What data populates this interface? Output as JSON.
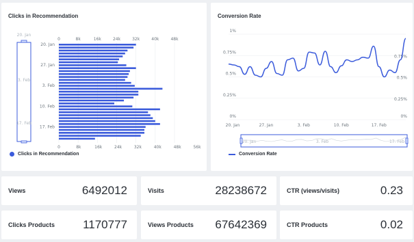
{
  "colors": {
    "series": "#3b5bdb",
    "grid": "#e9ecef",
    "axis_text": "#6c757d",
    "navigator_mask": "#3b5bdb"
  },
  "clicks_card": {
    "title": "Clicks in Recommendation",
    "legend": "Clicks in Recommendation",
    "navigator_labels": [
      "20. Jan",
      "3. Feb",
      "17. Feb"
    ]
  },
  "conversion_card": {
    "title": "Conversion Rate",
    "legend": "Conversion Rate",
    "navigator_labels": [
      "20. Jan",
      "3. Feb",
      "17. Feb"
    ]
  },
  "stats": [
    {
      "label": "Views",
      "value": "6492012"
    },
    {
      "label": "Visits",
      "value": "28238672"
    },
    {
      "label": "CTR (views/visits)",
      "value": "0.23"
    },
    {
      "label": "Clicks Products",
      "value": "1170777"
    },
    {
      "label": "Views Products",
      "value": "67642369"
    },
    {
      "label": "CTR Products",
      "value": "0.02"
    }
  ],
  "chart_data": [
    {
      "type": "bar",
      "orientation": "horizontal",
      "title": "Clicks in Recommendation",
      "top_axis_ticks": [
        "0",
        "8k",
        "16k",
        "24k",
        "32k",
        "40k",
        "48k"
      ],
      "top_axis_max": 48000,
      "bottom_axis_ticks": [
        "0",
        "8k",
        "16k",
        "24k",
        "32k",
        "40k",
        "48k",
        "56k"
      ],
      "bottom_axis_max": 56000,
      "category_labels": [
        "20. Jan",
        "27. Jan",
        "3. Feb",
        "10. Feb",
        "17. Feb"
      ],
      "label_indices": [
        0,
        7,
        14,
        21,
        28
      ],
      "series": [
        {
          "name": "Clicks in Recommendation",
          "values": [
            32000,
            31000,
            28500,
            27500,
            26500,
            25000,
            24500,
            28000,
            32000,
            29500,
            29000,
            28500,
            27500,
            30000,
            31500,
            43000,
            33000,
            33000,
            31000,
            27000,
            23000,
            30500,
            42000,
            37000,
            38000,
            39000,
            40000,
            42000,
            36000,
            35500,
            35500,
            34000,
            15000
          ]
        }
      ]
    },
    {
      "type": "line",
      "title": "Conversion Rate",
      "x_ticks": [
        "20. Jan",
        "27. Jan",
        "3. Feb",
        "10. Feb",
        "17. Feb"
      ],
      "left_axis_ticks": [
        "0%",
        "0.25%",
        "0.5%",
        "0.75%",
        "1%"
      ],
      "right_axis_ticks": [
        "0%",
        "0.25%",
        "0.5%",
        "0.75%"
      ],
      "ylim": [
        0,
        1
      ],
      "series": [
        {
          "name": "Conversion Rate",
          "x": [
            0,
            1,
            2,
            3,
            4,
            5,
            6,
            7,
            8,
            9,
            10,
            11,
            12,
            13,
            14,
            15,
            16,
            17,
            18,
            19,
            20,
            21,
            22,
            23,
            24,
            25,
            26,
            27,
            28,
            29,
            30,
            31,
            32,
            33
          ],
          "values": [
            0.65,
            0.64,
            0.62,
            0.53,
            0.62,
            0.52,
            0.5,
            0.6,
            0.68,
            0.54,
            0.52,
            0.7,
            0.72,
            0.57,
            0.6,
            0.79,
            0.78,
            0.64,
            0.8,
            0.62,
            0.55,
            0.63,
            0.7,
            0.68,
            0.7,
            0.73,
            0.72,
            0.86,
            0.62,
            0.5,
            0.58,
            0.55,
            0.7,
            0.95
          ]
        }
      ]
    }
  ]
}
